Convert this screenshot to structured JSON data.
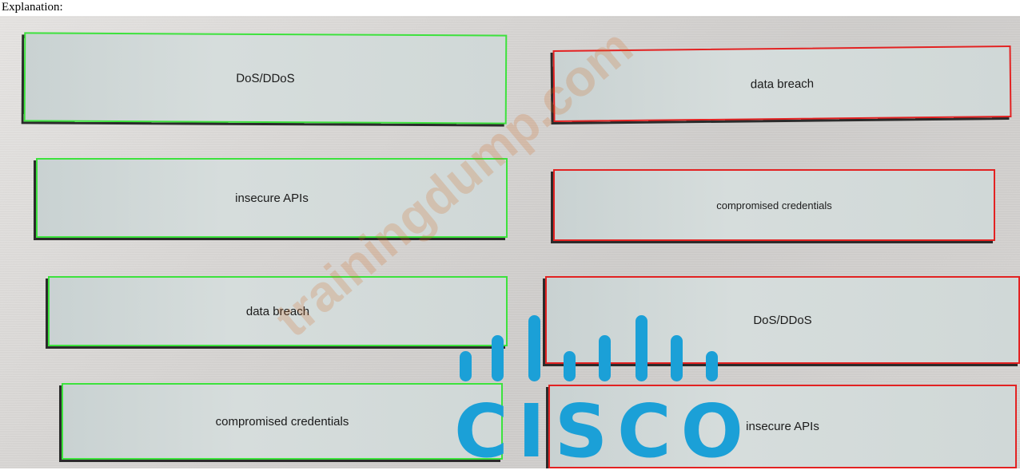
{
  "header": {
    "text": "Explanation:"
  },
  "left_items": [
    "DoS/DDoS",
    "insecure APIs",
    "data breach",
    "compromised credentials"
  ],
  "right_items": [
    "data breach",
    "compromised credentials",
    "DoS/DDoS",
    "insecure APIs"
  ],
  "watermark": {
    "text": "trainingdump.com"
  },
  "logo": {
    "text": "CISCO"
  },
  "colors": {
    "correct_border": "#3de23d",
    "answer_border": "#e32222",
    "logo": "#1ba0d7"
  }
}
